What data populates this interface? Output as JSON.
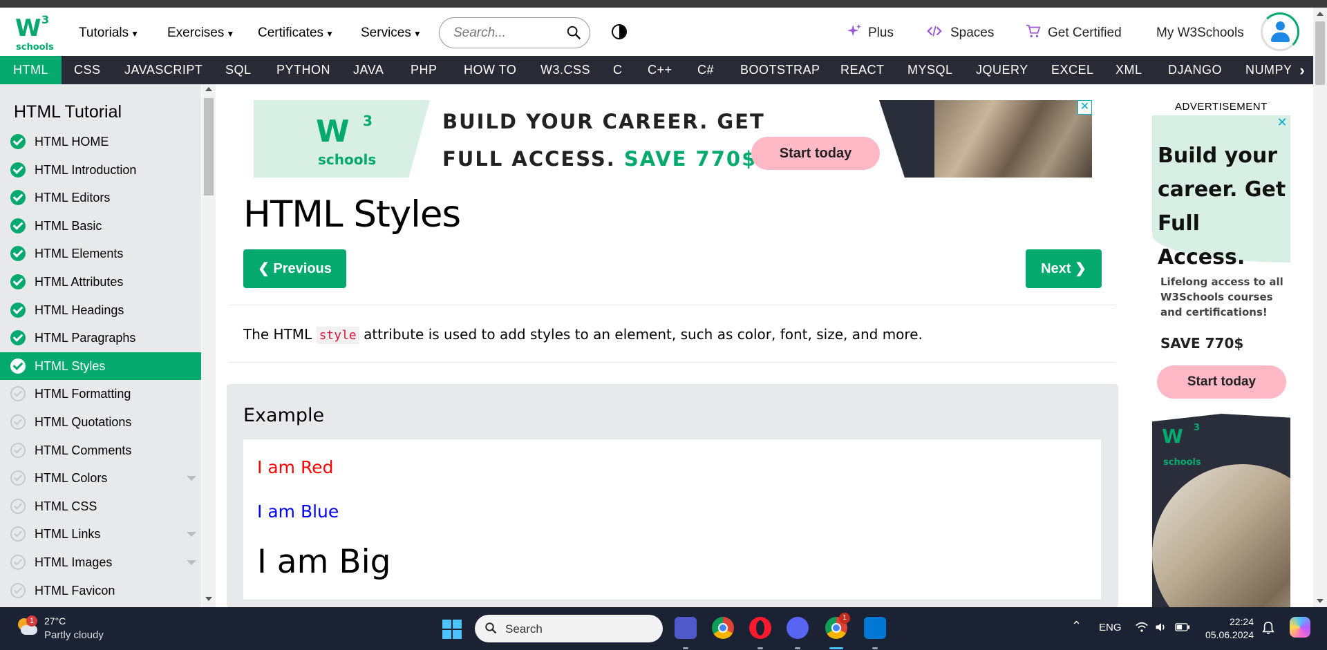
{
  "header": {
    "menus": [
      "Tutorials",
      "Exercises",
      "Certificates",
      "Services"
    ],
    "search_placeholder": "Search...",
    "links": {
      "plus": "Plus",
      "spaces": "Spaces",
      "get_certified": "Get Certified",
      "my": "My W3Schools"
    },
    "logo_text": "schools",
    "logo_w": "W",
    "logo_sup": "3"
  },
  "topnav": {
    "items": [
      "HTML",
      "CSS",
      "JAVASCRIPT",
      "SQL",
      "PYTHON",
      "JAVA",
      "PHP",
      "HOW TO",
      "W3.CSS",
      "C",
      "C++",
      "C#",
      "BOOTSTRAP",
      "REACT",
      "MYSQL",
      "JQUERY",
      "EXCEL",
      "XML",
      "DJANGO",
      "NUMPY"
    ],
    "active": "HTML"
  },
  "sidebar": {
    "title": "HTML Tutorial",
    "items": [
      {
        "label": "HTML HOME",
        "done": true
      },
      {
        "label": "HTML Introduction",
        "done": true
      },
      {
        "label": "HTML Editors",
        "done": true
      },
      {
        "label": "HTML Basic",
        "done": true
      },
      {
        "label": "HTML Elements",
        "done": true
      },
      {
        "label": "HTML Attributes",
        "done": true
      },
      {
        "label": "HTML Headings",
        "done": true
      },
      {
        "label": "HTML Paragraphs",
        "done": true
      },
      {
        "label": "HTML Styles",
        "done": true,
        "active": true
      },
      {
        "label": "HTML Formatting",
        "done": false
      },
      {
        "label": "HTML Quotations",
        "done": false
      },
      {
        "label": "HTML Comments",
        "done": false
      },
      {
        "label": "HTML Colors",
        "done": false,
        "expand": true
      },
      {
        "label": "HTML CSS",
        "done": false
      },
      {
        "label": "HTML Links",
        "done": false,
        "expand": true
      },
      {
        "label": "HTML Images",
        "done": false,
        "expand": true
      },
      {
        "label": "HTML Favicon",
        "done": false
      }
    ]
  },
  "ad_top": {
    "line1": "BUILD YOUR CAREER. GET",
    "line2_a": "FULL ACCESS.",
    "line2_b": "SAVE 770$",
    "button": "Start today",
    "close": "✕"
  },
  "main": {
    "title": "HTML Styles",
    "prev": "❮ Previous",
    "next": "Next ❯",
    "intro_a": "The HTML",
    "intro_code": "style",
    "intro_b": "attribute is used to add styles to an element, such as color, font, size, and more.",
    "example_heading": "Example",
    "example_lines": [
      {
        "text": "I am Red",
        "color": "#ff0000"
      },
      {
        "text": "I am Blue",
        "color": "#0000ff"
      },
      {
        "text": "I am Big",
        "color": "#000000"
      }
    ]
  },
  "ad_right": {
    "label": "ADVERTISEMENT",
    "heading_lines": [
      "Build your",
      "career. Get",
      "Full Access."
    ],
    "para": "Lifelong access to all W3Schools courses and certifications!",
    "save": "SAVE 770$",
    "button": "Start today",
    "close": "✕"
  },
  "taskbar": {
    "weather_badge": "1",
    "temperature": "27°C",
    "condition": "Partly cloudy",
    "search": "Search",
    "lang": "ENG",
    "time": "22:24",
    "date": "05.06.2024",
    "chrome_badge": "1"
  },
  "colors": {
    "brand": "#04AA6D",
    "nav_dark": "#282A35",
    "sidebar_bg": "#E7E9EB"
  }
}
